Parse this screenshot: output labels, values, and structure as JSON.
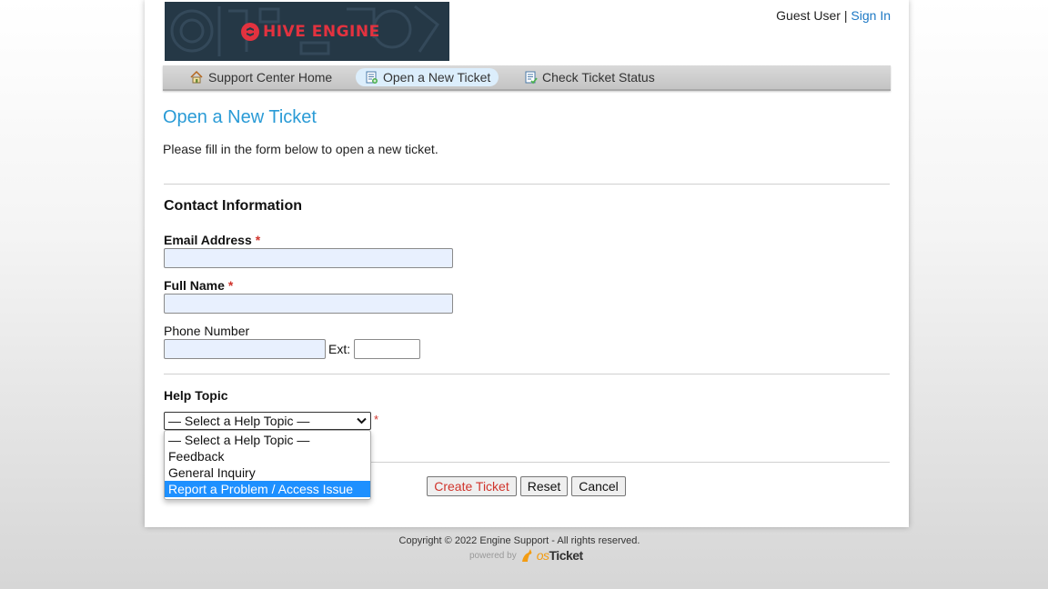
{
  "logo": {
    "text": "HIVE ENGINE"
  },
  "header": {
    "user_label": "Guest User",
    "separator": "|",
    "signin_label": "Sign In"
  },
  "nav": {
    "items": [
      {
        "label": "Support Center Home",
        "icon": "home-icon",
        "active": false
      },
      {
        "label": "Open a New Ticket",
        "icon": "new-ticket-icon",
        "active": true
      },
      {
        "label": "Check Ticket Status",
        "icon": "ticket-status-icon",
        "active": false
      }
    ]
  },
  "page": {
    "title": "Open a New Ticket",
    "intro": "Please fill in the form below to open a new ticket."
  },
  "contact": {
    "heading": "Contact Information",
    "email_label": "Email Address",
    "email_value": "",
    "name_label": "Full Name",
    "name_value": "",
    "phone_label": "Phone Number",
    "phone_value": "",
    "ext_label": "Ext:",
    "ext_value": "",
    "required_mark": "*"
  },
  "help_topic": {
    "label": "Help Topic",
    "selected": "— Select a Help Topic —",
    "required_mark": "*",
    "options": [
      "— Select a Help Topic —",
      "Feedback",
      "General Inquiry",
      "Report a Problem / Access Issue"
    ],
    "highlighted_index": 3
  },
  "buttons": {
    "create": "Create Ticket",
    "reset": "Reset",
    "cancel": "Cancel"
  },
  "footer": {
    "copyright": "Copyright © 2022 Engine Support - All rights reserved.",
    "powered_by": "powered by",
    "osticket_os": "os",
    "osticket_ticket": "Ticket"
  },
  "colors": {
    "accent": "#2a9bd6",
    "link": "#1c78c4",
    "required": "#d0342c",
    "highlight": "#1e90ff",
    "logo_bg": "#253846",
    "logo_red": "#e3323f"
  }
}
